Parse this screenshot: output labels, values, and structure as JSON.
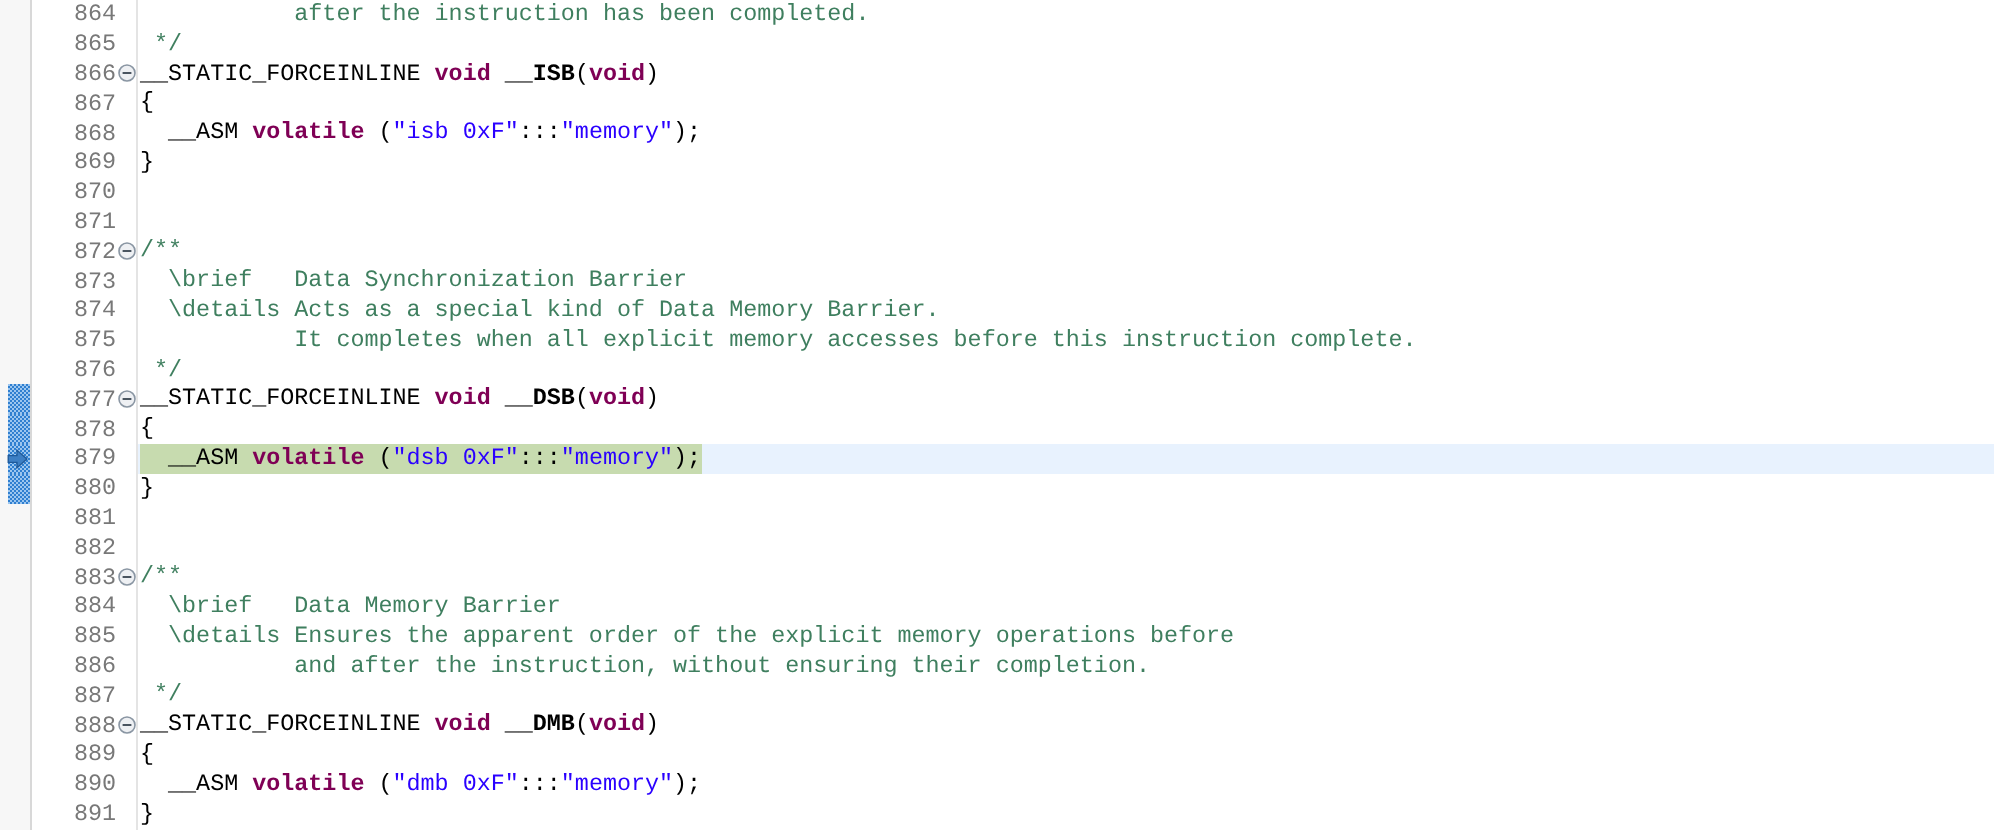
{
  "editor": {
    "lines": [
      {
        "number": "864",
        "fold": false,
        "range": false,
        "current": false,
        "tokens": [
          {
            "kind": "comment",
            "text": "           after the instruction has been completed."
          }
        ]
      },
      {
        "number": "865",
        "fold": false,
        "range": false,
        "current": false,
        "tokens": [
          {
            "kind": "comment",
            "text": " */"
          }
        ]
      },
      {
        "number": "866",
        "fold": true,
        "range": false,
        "current": false,
        "tokens": [
          {
            "kind": "plain",
            "text": "__STATIC_FORCEINLINE "
          },
          {
            "kind": "keyword",
            "text": "void"
          },
          {
            "kind": "function",
            "text": " __ISB"
          },
          {
            "kind": "plain",
            "text": "("
          },
          {
            "kind": "keyword",
            "text": "void"
          },
          {
            "kind": "plain",
            "text": ")"
          }
        ]
      },
      {
        "number": "867",
        "fold": false,
        "range": false,
        "current": false,
        "tokens": [
          {
            "kind": "plain",
            "text": "{"
          }
        ]
      },
      {
        "number": "868",
        "fold": false,
        "range": false,
        "current": false,
        "tokens": [
          {
            "kind": "plain",
            "text": "  __ASM "
          },
          {
            "kind": "keyword",
            "text": "volatile"
          },
          {
            "kind": "plain",
            "text": " ("
          },
          {
            "kind": "string",
            "text": "\"isb 0xF\""
          },
          {
            "kind": "plain",
            "text": ":::"
          },
          {
            "kind": "string",
            "text": "\"memory\""
          },
          {
            "kind": "plain",
            "text": ");"
          }
        ]
      },
      {
        "number": "869",
        "fold": false,
        "range": false,
        "current": false,
        "tokens": [
          {
            "kind": "plain",
            "text": "}"
          }
        ]
      },
      {
        "number": "870",
        "fold": false,
        "range": false,
        "current": false
      },
      {
        "number": "871",
        "fold": false,
        "range": false,
        "current": false
      },
      {
        "number": "872",
        "fold": true,
        "range": false,
        "current": false,
        "tokens": [
          {
            "kind": "comment",
            "text": "/**"
          }
        ]
      },
      {
        "number": "873",
        "fold": false,
        "range": false,
        "current": false,
        "tokens": [
          {
            "kind": "comment",
            "text": "  \\brief   Data Synchronization Barrier"
          }
        ]
      },
      {
        "number": "874",
        "fold": false,
        "range": false,
        "current": false,
        "tokens": [
          {
            "kind": "comment",
            "text": "  \\details Acts as a special kind of Data Memory Barrier."
          }
        ]
      },
      {
        "number": "875",
        "fold": false,
        "range": false,
        "current": false,
        "tokens": [
          {
            "kind": "comment",
            "text": "           It completes when all explicit memory accesses before this instruction complete."
          }
        ]
      },
      {
        "number": "876",
        "fold": false,
        "range": false,
        "current": false,
        "tokens": [
          {
            "kind": "comment",
            "text": " */"
          }
        ]
      },
      {
        "number": "877",
        "fold": true,
        "range": true,
        "current": false,
        "tokens": [
          {
            "kind": "plain",
            "text": "__STATIC_FORCEINLINE "
          },
          {
            "kind": "keyword",
            "text": "void"
          },
          {
            "kind": "function",
            "text": " __DSB"
          },
          {
            "kind": "plain",
            "text": "("
          },
          {
            "kind": "keyword",
            "text": "void"
          },
          {
            "kind": "plain",
            "text": ")"
          }
        ]
      },
      {
        "number": "878",
        "fold": false,
        "range": true,
        "current": false,
        "tokens": [
          {
            "kind": "plain",
            "text": "{"
          }
        ]
      },
      {
        "number": "879",
        "fold": false,
        "range": true,
        "current": true,
        "tokens": [
          {
            "kind": "plain",
            "text": "  __ASM "
          },
          {
            "kind": "keyword",
            "text": "volatile"
          },
          {
            "kind": "plain",
            "text": " ("
          },
          {
            "kind": "string",
            "text": "\"dsb 0xF\""
          },
          {
            "kind": "plain",
            "text": ":::"
          },
          {
            "kind": "string",
            "text": "\"memory\""
          },
          {
            "kind": "plain",
            "text": ");"
          }
        ]
      },
      {
        "number": "880",
        "fold": false,
        "range": true,
        "current": false,
        "tokens": [
          {
            "kind": "plain",
            "text": "}"
          }
        ]
      },
      {
        "number": "881",
        "fold": false,
        "range": false,
        "current": false
      },
      {
        "number": "882",
        "fold": false,
        "range": false,
        "current": false
      },
      {
        "number": "883",
        "fold": true,
        "range": false,
        "current": false,
        "tokens": [
          {
            "kind": "comment",
            "text": "/**"
          }
        ]
      },
      {
        "number": "884",
        "fold": false,
        "range": false,
        "current": false,
        "tokens": [
          {
            "kind": "comment",
            "text": "  \\brief   Data Memory Barrier"
          }
        ]
      },
      {
        "number": "885",
        "fold": false,
        "range": false,
        "current": false,
        "tokens": [
          {
            "kind": "comment",
            "text": "  \\details Ensures the apparent order of the explicit memory operations before"
          }
        ]
      },
      {
        "number": "886",
        "fold": false,
        "range": false,
        "current": false,
        "tokens": [
          {
            "kind": "comment",
            "text": "           and after the instruction, without ensuring their completion."
          }
        ]
      },
      {
        "number": "887",
        "fold": false,
        "range": false,
        "current": false,
        "tokens": [
          {
            "kind": "comment",
            "text": " */"
          }
        ]
      },
      {
        "number": "888",
        "fold": true,
        "range": false,
        "current": false,
        "tokens": [
          {
            "kind": "plain",
            "text": "__STATIC_FORCEINLINE "
          },
          {
            "kind": "keyword",
            "text": "void"
          },
          {
            "kind": "function",
            "text": " __DMB"
          },
          {
            "kind": "plain",
            "text": "("
          },
          {
            "kind": "keyword",
            "text": "void"
          },
          {
            "kind": "plain",
            "text": ")"
          }
        ]
      },
      {
        "number": "889",
        "fold": false,
        "range": false,
        "current": false,
        "tokens": [
          {
            "kind": "plain",
            "text": "{"
          }
        ]
      },
      {
        "number": "890",
        "fold": false,
        "range": false,
        "current": false,
        "tokens": [
          {
            "kind": "plain",
            "text": "  __ASM "
          },
          {
            "kind": "keyword",
            "text": "volatile"
          },
          {
            "kind": "plain",
            "text": " ("
          },
          {
            "kind": "string",
            "text": "\"dmb 0xF\""
          },
          {
            "kind": "plain",
            "text": ":::"
          },
          {
            "kind": "string",
            "text": "\"memory\""
          },
          {
            "kind": "plain",
            "text": ");"
          }
        ]
      },
      {
        "number": "891",
        "fold": false,
        "range": false,
        "current": false,
        "tokens": [
          {
            "kind": "plain",
            "text": "}"
          }
        ]
      }
    ]
  }
}
